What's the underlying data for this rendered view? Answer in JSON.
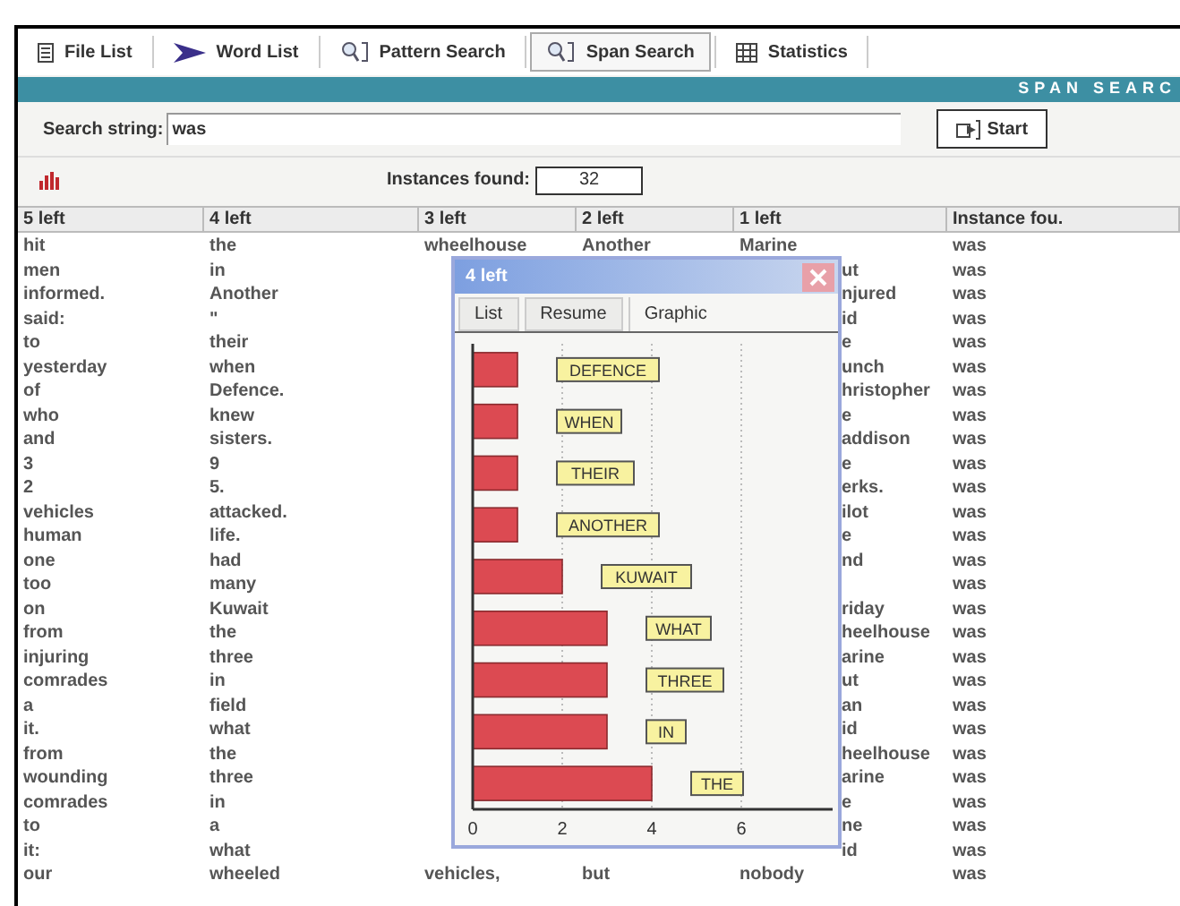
{
  "toolbar": {
    "tabs": [
      {
        "label": "File List",
        "kind": "file",
        "selected": false
      },
      {
        "label": "Word List",
        "kind": "arrow",
        "selected": false
      },
      {
        "label": "Pattern Search",
        "kind": "search",
        "selected": false
      },
      {
        "label": "Span Search",
        "kind": "search",
        "selected": true
      },
      {
        "label": "Statistics",
        "kind": "grid",
        "selected": false
      }
    ]
  },
  "banner": {
    "text": "SPAN SEARC"
  },
  "search": {
    "label": "Search string:",
    "value": "was",
    "button": "Start"
  },
  "instances": {
    "label": "Instances found:",
    "value": "32"
  },
  "table": {
    "columns": [
      "5 left",
      "4 left",
      "3 left",
      "2 left",
      "1 left",
      "Instance fou."
    ],
    "rows": [
      [
        "hit",
        "the",
        "wheelhouse",
        "Another",
        "Marine",
        "was"
      ],
      [
        "men",
        "in",
        null,
        null,
        "ut",
        "was"
      ],
      [
        "informed.",
        "Another",
        null,
        null,
        "njured",
        "was"
      ],
      [
        "said:",
        "\"",
        null,
        null,
        "id",
        "was"
      ],
      [
        "to",
        "their",
        null,
        null,
        "e",
        "was"
      ],
      [
        "yesterday",
        "when",
        null,
        null,
        "unch",
        "was"
      ],
      [
        "of",
        "Defence.",
        null,
        null,
        "hristopher",
        "was"
      ],
      [
        "who",
        "knew",
        null,
        null,
        "e",
        "was"
      ],
      [
        "and",
        "sisters.",
        null,
        null,
        "addison",
        "was"
      ],
      [
        "3",
        "9",
        null,
        null,
        "e",
        "was"
      ],
      [
        "2",
        "5.",
        null,
        null,
        "erks.",
        "was"
      ],
      [
        "vehicles",
        "attacked.",
        null,
        null,
        "ilot",
        "was"
      ],
      [
        "human",
        "life.",
        null,
        null,
        "e",
        "was"
      ],
      [
        "one",
        "had",
        null,
        null,
        "nd",
        "was"
      ],
      [
        "too",
        "many",
        null,
        null,
        null,
        "was"
      ],
      [
        "on",
        "Kuwait",
        null,
        null,
        "riday",
        "was"
      ],
      [
        "from",
        "the",
        null,
        null,
        "heelhouse",
        "was"
      ],
      [
        "injuring",
        "three",
        null,
        null,
        "arine",
        "was"
      ],
      [
        "comrades",
        "in",
        null,
        null,
        "ut",
        "was"
      ],
      [
        "a",
        "field",
        null,
        null,
        "an",
        "was"
      ],
      [
        "it.",
        "what",
        null,
        null,
        "id",
        "was"
      ],
      [
        "from",
        "the",
        null,
        null,
        "heelhouse",
        "was"
      ],
      [
        "wounding",
        "three",
        null,
        null,
        "arine",
        "was"
      ],
      [
        "comrades",
        "in",
        null,
        null,
        "e",
        "was"
      ],
      [
        "to",
        "a",
        null,
        null,
        "ne",
        "was"
      ],
      [
        "it:",
        "what",
        null,
        null,
        "id",
        "was"
      ],
      [
        "our",
        "wheeled",
        "vehicles,",
        "but",
        "nobody",
        "was"
      ]
    ]
  },
  "popup": {
    "title": "4 left",
    "tabs": [
      {
        "label": "List",
        "selected": false
      },
      {
        "label": "Resume",
        "selected": false
      },
      {
        "label": "Graphic",
        "selected": true
      }
    ],
    "chart_data": {
      "type": "bar",
      "orientation": "horizontal",
      "categories": [
        "DEFENCE",
        "WHEN",
        "THEIR",
        "ANOTHER",
        "KUWAIT",
        "WHAT",
        "THREE",
        "IN",
        "THE"
      ],
      "values": [
        1,
        1,
        1,
        1,
        2,
        3,
        3,
        3,
        4
      ],
      "xlim": [
        0,
        8
      ],
      "xticks": [
        0,
        2,
        4,
        6
      ],
      "grid": true
    }
  }
}
